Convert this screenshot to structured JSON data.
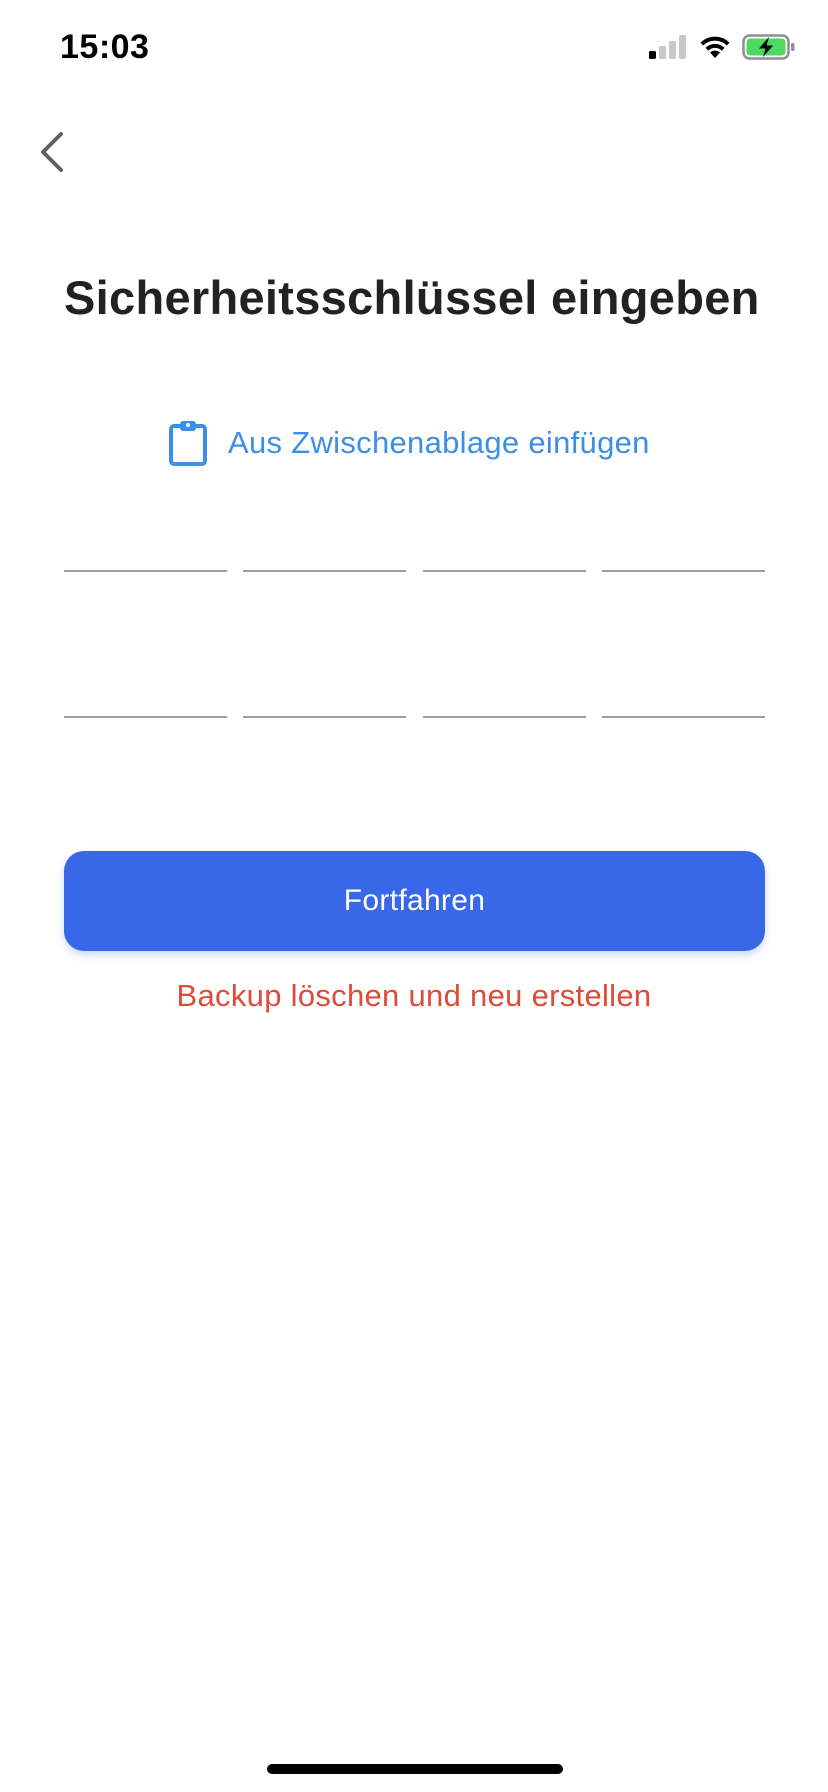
{
  "status_bar": {
    "time": "15:03",
    "signal_icon": "cellular-signal-icon",
    "wifi_icon": "wifi-icon",
    "battery_icon": "battery-charging-icon",
    "battery_color": "#4cd964"
  },
  "nav": {
    "back_icon": "chevron-left-icon"
  },
  "title": "Sicherheitsschlüssel eingeben",
  "paste": {
    "icon": "clipboard-icon",
    "label": "Aus Zwischenablage einfügen",
    "color": "#3d8fe6"
  },
  "key_fields": {
    "rows": [
      [
        "",
        "",
        "",
        ""
      ],
      [
        "",
        "",
        "",
        ""
      ]
    ]
  },
  "continue_button": {
    "label": "Fortfahren",
    "color": "#3867e8"
  },
  "reset_link": {
    "label": "Backup löschen und neu erstellen",
    "color": "#dd4b39"
  }
}
